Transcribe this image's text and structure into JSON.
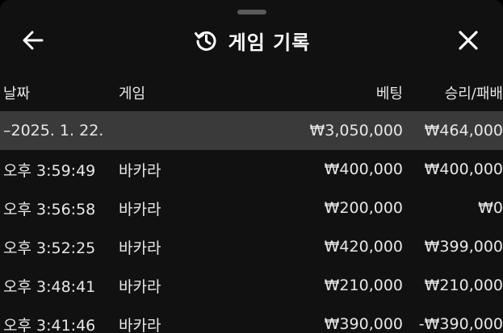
{
  "header": {
    "title": "게임 기록",
    "back_icon": "arrow-left-icon",
    "history_icon": "history-icon",
    "close_icon": "close-icon"
  },
  "columns": {
    "date": "날짜",
    "game": "게임",
    "bet": "베팅",
    "result": "승리/패배"
  },
  "date_group": {
    "date": "–2025. 1. 22.",
    "bet_total": "₩3,050,000",
    "result_total": "₩464,000"
  },
  "rows": [
    {
      "time": "오후 3:59:49",
      "game": "바카라",
      "bet": "₩400,000",
      "result": "₩400,000"
    },
    {
      "time": "오후 3:56:58",
      "game": "바카라",
      "bet": "₩200,000",
      "result": "₩0"
    },
    {
      "time": "오후 3:52:25",
      "game": "바카라",
      "bet": "₩420,000",
      "result": "₩399,000"
    },
    {
      "time": "오후 3:48:41",
      "game": "바카라",
      "bet": "₩210,000",
      "result": "₩210,000"
    },
    {
      "time": "오후 3:41:46",
      "game": "바카라",
      "bet": "₩390,000",
      "result": "-₩390,000"
    }
  ]
}
